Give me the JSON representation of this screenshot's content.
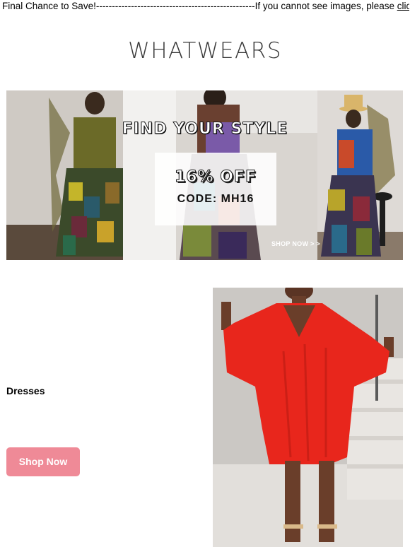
{
  "preheader": {
    "text": "Final Chance to Save!--------------------------------------------------If you cannot see images, please ",
    "link_label": "click here"
  },
  "brand": {
    "logo_text": "WHATWEARS"
  },
  "banner": {
    "headline": "FIND YOUR STYLE",
    "discount": "16% OFF",
    "code": "CODE: MH16",
    "cta": "SHOP NOW > >"
  },
  "featured": {
    "category": "Dresses",
    "button_label": "Shop Now"
  },
  "colors": {
    "button": "#ef8a97",
    "dress": "#e8261c",
    "logo": "#3a3a3a"
  }
}
